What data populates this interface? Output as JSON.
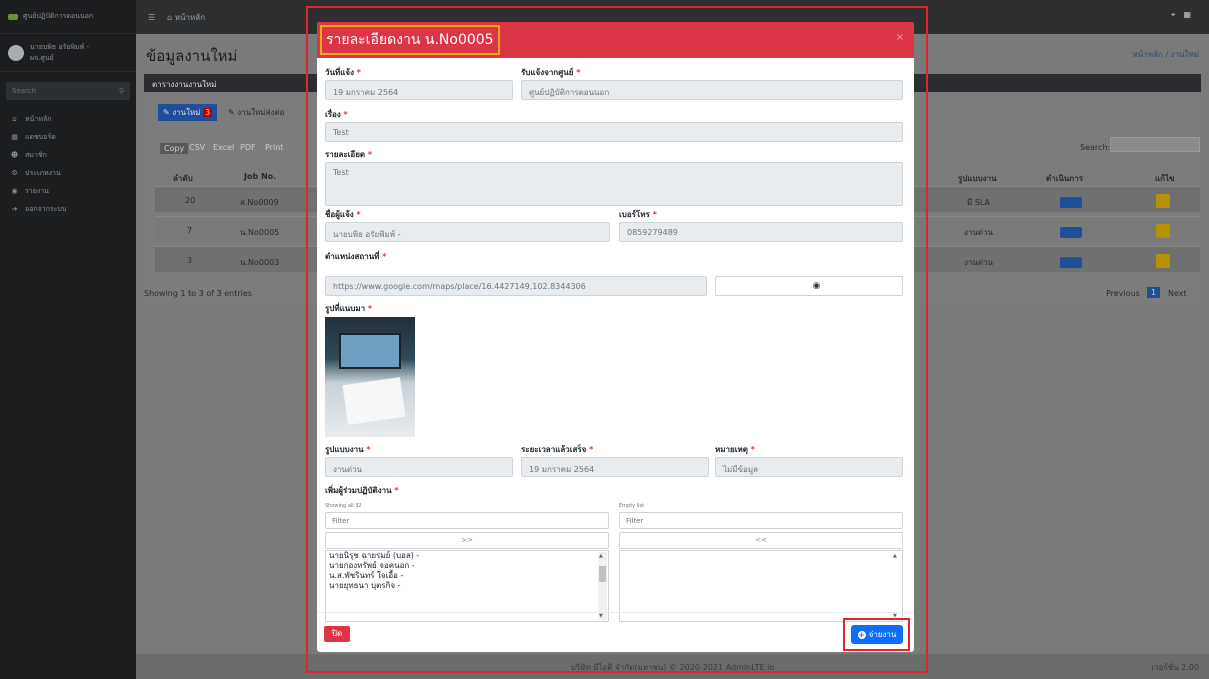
{
  "app": {
    "brand": "ศูนย์ปฏิบัติการตอนนอก",
    "user_name": "นายบพิธ อรัยพิมพ์ -",
    "user_role": "ผจ.ศูนย์"
  },
  "sidebar": {
    "search_placeholder": "Search",
    "items": [
      {
        "icon": "home-icon",
        "label": "หน้าหลัก"
      },
      {
        "icon": "chart-icon",
        "label": "แดชบอร์ด"
      },
      {
        "icon": "users-icon",
        "label": "สมาชิก"
      },
      {
        "icon": "cogs-icon",
        "label": "ประเภทงาน"
      },
      {
        "icon": "globe-icon",
        "label": "รายงาน"
      },
      {
        "icon": "signout-icon",
        "label": "ออกจากระบบ"
      }
    ]
  },
  "topbar": {
    "home_label": "หน้าหลัก"
  },
  "page": {
    "title": "ข้อมูลงานใหม่",
    "breadcrumb": "หน้าหลัก / งานใหม่",
    "card_title": "ตารางงานงานใหม่"
  },
  "background_table": {
    "tabs": [
      "งานใหม่",
      "งานใหม่ส่งต่อ"
    ],
    "new_count": "3",
    "export_buttons": [
      "Copy",
      "CSV",
      "Excel",
      "PDF",
      "Print"
    ],
    "search_label": "Search:",
    "headers": [
      "ลำดับ",
      "Job No.",
      "รูปแบบงาน",
      "ดำเนินการ",
      "แก้ไข"
    ],
    "rows": [
      {
        "no": "20",
        "job": "ส.No0009",
        "type": "มี SLA",
        "action": "แสดง"
      },
      {
        "no": "7",
        "job": "น.No0005",
        "type": "งานด่วน",
        "action": "แสดง"
      },
      {
        "no": "3",
        "job": "น.No0003",
        "type": "งานด่วน",
        "action": "แสดง"
      }
    ],
    "info": "Showing 1 to 3 of 3 entries",
    "pager": {
      "prev": "Previous",
      "page": "1",
      "next": "Next"
    }
  },
  "footer": {
    "copyright": "บริษัท มีไอดี จำกัด(มหาชน) © 2020-2021 AdminLTE.io",
    "version": "เวอร์ชั่น 2.00"
  },
  "modal": {
    "title": "รายละเอียดงาน น.No0005",
    "close_symbol": "×",
    "fields": {
      "report_date": {
        "label": "วันที่แจ้ง",
        "value": "19 มกราคม 2564"
      },
      "received_from": {
        "label": "รับแจ้งจากศูนย์",
        "value": "ศูนย์ปฏิบัติการตอนนอก"
      },
      "subject": {
        "label": "เรื่อง",
        "value": "Test"
      },
      "details": {
        "label": "รายละเอียด",
        "value": "Test"
      },
      "reporter": {
        "label": "ชื่อผู้แจ้ง",
        "value": "นายบพิธ อรัยพิมพ์  -"
      },
      "phone": {
        "label": "เบอร์โทร",
        "value": "0859279489"
      },
      "location": {
        "label": "ตำแหน่งสถานที่",
        "value": "https://www.google.com/maps/place/16.4427149,102.8344306"
      },
      "attached_photo": {
        "label": "รูปที่แนบมา"
      },
      "job_type": {
        "label": "รูปแบบงาน",
        "value": "งานด่วน"
      },
      "duration": {
        "label": "ระยะเวลาแล้วเสร็จ",
        "value": "19 มกราคม 2564"
      },
      "note": {
        "label": "หมายเหตุ",
        "value": "ไม่มีข้อมูล"
      },
      "add_coworkers": {
        "label": "เพิ่มผู้ร่วมปฏิบัติงาน"
      }
    },
    "dual_list": {
      "left_info": "Showing all 32",
      "right_info": "Empty list",
      "filter_placeholder": "Filter",
      "move_all_right": ">>",
      "move_all_left": "<<",
      "options": [
        "นายนิรุช ฉายรมย์ (บอล) -",
        "นายกองทรัพย์ จอคนอก -",
        "น.ส.พัชรินทร์ ใจเอื้อ -",
        "นายยุทธนา บุตรกิจ -"
      ]
    },
    "buttons": {
      "close": "ปิด",
      "assign": "จ่ายงาน"
    }
  }
}
